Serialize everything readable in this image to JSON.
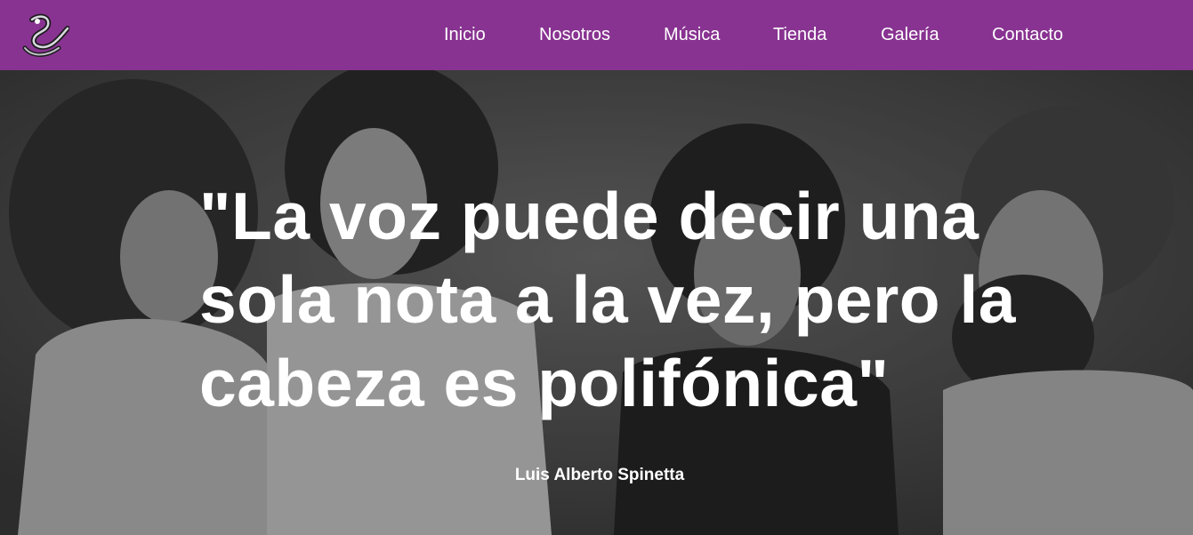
{
  "navbar": {
    "background": "#883391",
    "logo_icon": "serpent-logo-icon",
    "items": [
      {
        "label": "Inicio"
      },
      {
        "label": "Nosotros"
      },
      {
        "label": "Música"
      },
      {
        "label": "Tienda"
      },
      {
        "label": "Galería"
      },
      {
        "label": "Contacto"
      }
    ]
  },
  "hero": {
    "quote": "\"La voz puede decir una sola nota a la vez, pero la cabeza es polifónica\"",
    "author": "Luis Alberto Spinetta"
  }
}
